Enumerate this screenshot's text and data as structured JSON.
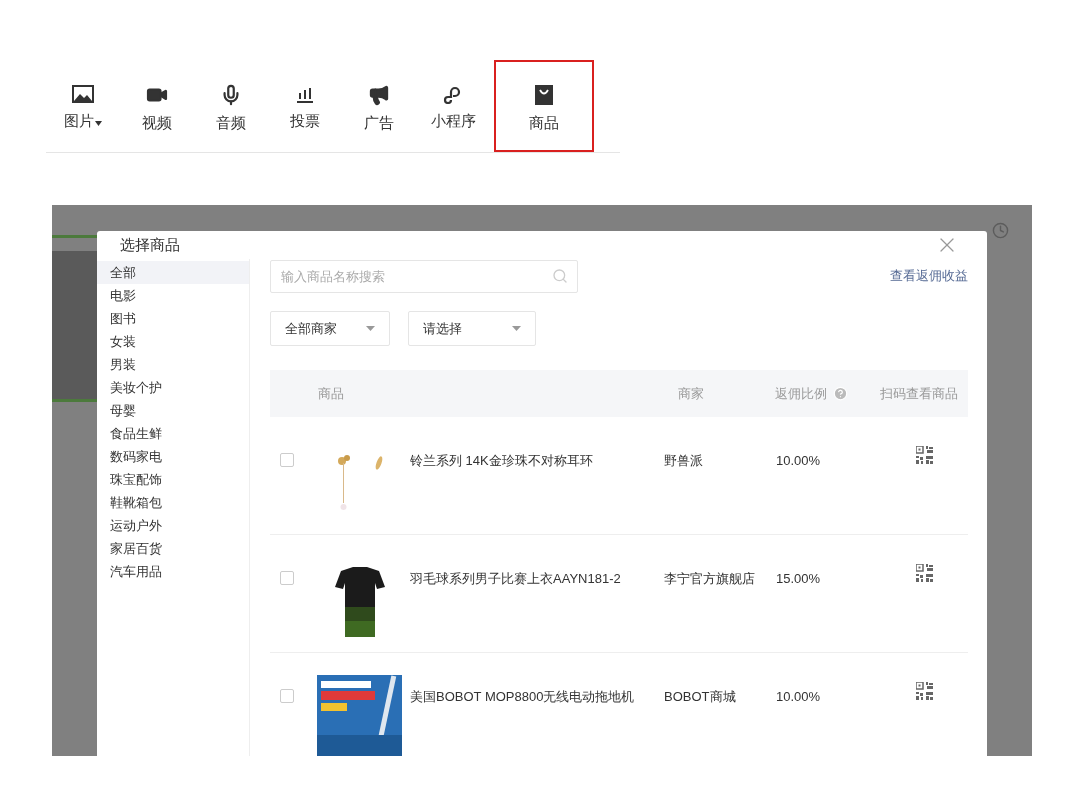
{
  "toolbar": {
    "items": [
      {
        "label": "图片",
        "dropdown": true,
        "highlighted": false
      },
      {
        "label": "视频",
        "dropdown": false,
        "highlighted": false
      },
      {
        "label": "音频",
        "dropdown": false,
        "highlighted": false
      },
      {
        "label": "投票",
        "dropdown": false,
        "highlighted": false
      },
      {
        "label": "广告",
        "dropdown": false,
        "highlighted": false
      },
      {
        "label": "小程序",
        "dropdown": false,
        "highlighted": false
      },
      {
        "label": "商品",
        "dropdown": false,
        "highlighted": true
      }
    ]
  },
  "dialog": {
    "title": "选择商品",
    "categories": [
      {
        "label": "全部",
        "selected": true
      },
      {
        "label": "电影",
        "selected": false
      },
      {
        "label": "图书",
        "selected": false
      },
      {
        "label": "女装",
        "selected": false
      },
      {
        "label": "男装",
        "selected": false
      },
      {
        "label": "美妆个护",
        "selected": false
      },
      {
        "label": "母婴",
        "selected": false
      },
      {
        "label": "食品生鲜",
        "selected": false
      },
      {
        "label": "数码家电",
        "selected": false
      },
      {
        "label": "珠宝配饰",
        "selected": false
      },
      {
        "label": "鞋靴箱包",
        "selected": false
      },
      {
        "label": "运动户外",
        "selected": false
      },
      {
        "label": "家居百货",
        "selected": false
      },
      {
        "label": "汽车用品",
        "selected": false
      }
    ],
    "search": {
      "placeholder": "输入商品名称搜索"
    },
    "link": "查看返佣收益",
    "filters": [
      {
        "value": "全部商家"
      },
      {
        "value": "请选择"
      }
    ],
    "table": {
      "columns": [
        "商品",
        "商家",
        "返佣比例",
        "扫码查看商品"
      ],
      "rows": [
        {
          "checked": false,
          "name": "铃兰系列 14K金珍珠不对称耳环",
          "merchant": "野兽派",
          "rate": "10.00%"
        },
        {
          "checked": false,
          "name": "羽毛球系列男子比赛上衣AAYN181-2",
          "merchant": "李宁官方旗舰店",
          "rate": "15.00%"
        },
        {
          "checked": false,
          "name": "美国BOBOT MOP8800无线电动拖地机",
          "merchant": "BOBOT商城",
          "rate": "10.00%"
        }
      ]
    }
  }
}
